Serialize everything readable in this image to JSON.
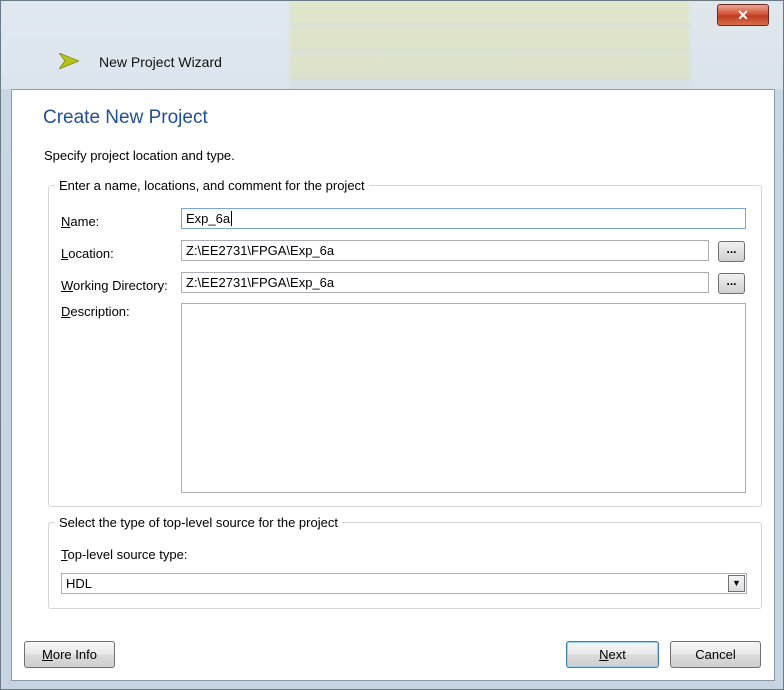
{
  "window": {
    "title": "New Project Wizard",
    "close_symbol": "✕"
  },
  "page": {
    "title": "Create New Project",
    "subtitle": "Specify project location and type."
  },
  "project_group": {
    "legend": "Enter a name, locations, and comment for the project",
    "name": {
      "label_key": "N",
      "label_rest": "ame:",
      "value": "Exp_6a"
    },
    "location": {
      "label_key": "L",
      "label_rest": "ocation:",
      "value": "Z:\\EE2731\\FPGA\\Exp_6a",
      "browse_label": "..."
    },
    "working_dir": {
      "label_key": "W",
      "label_rest": "orking Directory:",
      "value": "Z:\\EE2731\\FPGA\\Exp_6a",
      "browse_label": "..."
    },
    "description": {
      "label_key": "D",
      "label_rest": "escription:",
      "value": ""
    }
  },
  "source_group": {
    "legend": "Select the type of top-level source for the project",
    "type_label_key": "T",
    "type_label_rest": "op-level source type:",
    "selected": "HDL",
    "arrow": "▼"
  },
  "footer": {
    "more_info_key": "M",
    "more_info_rest": "ore Info",
    "next_key": "N",
    "next_rest": "ext",
    "cancel": "Cancel"
  },
  "colors": {
    "title_blue": "#1f4e9c",
    "close_red": "#c23a20",
    "logo_yellow": "#b8c21b"
  }
}
